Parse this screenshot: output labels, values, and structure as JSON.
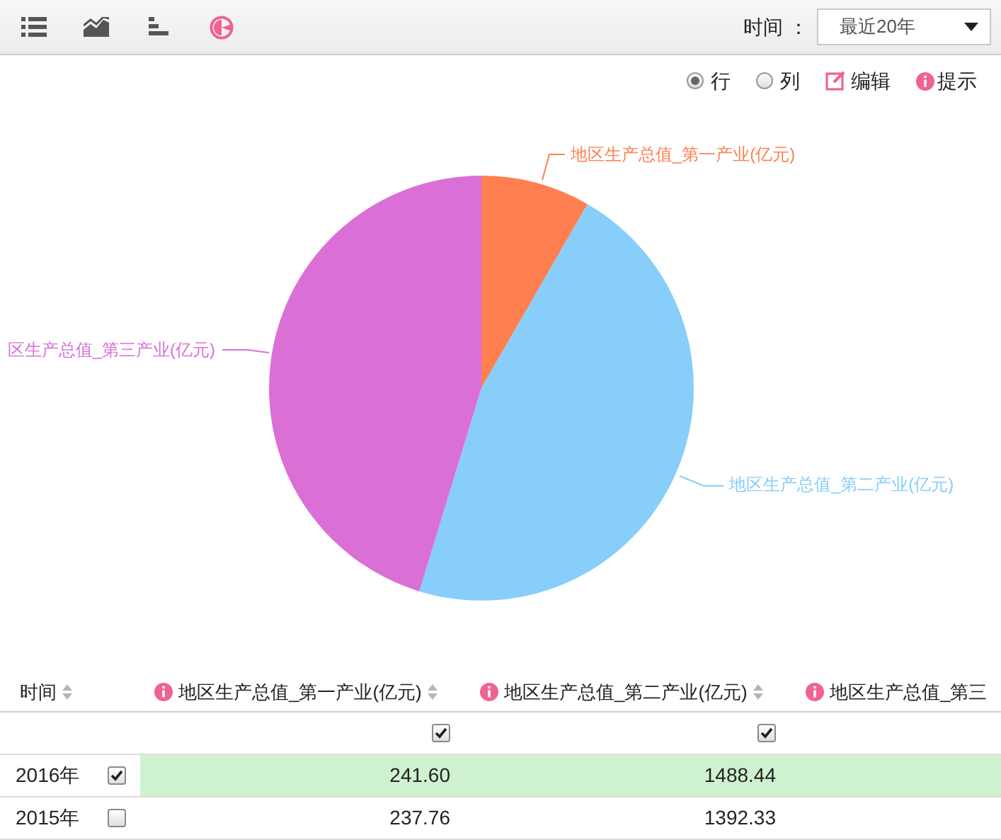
{
  "toolbar": {
    "views": [
      {
        "kind": "list",
        "selected": false
      },
      {
        "kind": "line",
        "selected": false
      },
      {
        "kind": "bar",
        "selected": false
      },
      {
        "kind": "pie",
        "selected": true
      }
    ],
    "time_label": "时间",
    "time_colon": "：",
    "time_select": "最近20年"
  },
  "options": {
    "orientation": [
      {
        "label": "行",
        "selected": true
      },
      {
        "label": "列",
        "selected": false
      }
    ],
    "edit": "编辑",
    "hint": "提示"
  },
  "pie": {
    "slices": [
      {
        "label": "地区生产总值_第一产业(亿元)",
        "color": "#ff7f50"
      },
      {
        "label": "地区生产总值_第二产业(亿元)",
        "color": "#87cefa"
      },
      {
        "label": "区生产总值_第三产业(亿元)",
        "color": "#da70d6"
      }
    ]
  },
  "table": {
    "columns": [
      {
        "label": "时间",
        "info": false
      },
      {
        "label": "地区生产总值_第一产业(亿元)",
        "info": true,
        "checked": true
      },
      {
        "label": "地区生产总值_第二产业(亿元)",
        "info": true,
        "checked": true
      },
      {
        "label": "地区生产总值_第三",
        "info": true
      }
    ],
    "rows": [
      {
        "time": "2016年",
        "selected": true,
        "values": [
          "241.60",
          "1488.44"
        ]
      },
      {
        "time": "2015年",
        "selected": false,
        "values": [
          "237.76",
          "1392.33"
        ]
      }
    ]
  }
}
